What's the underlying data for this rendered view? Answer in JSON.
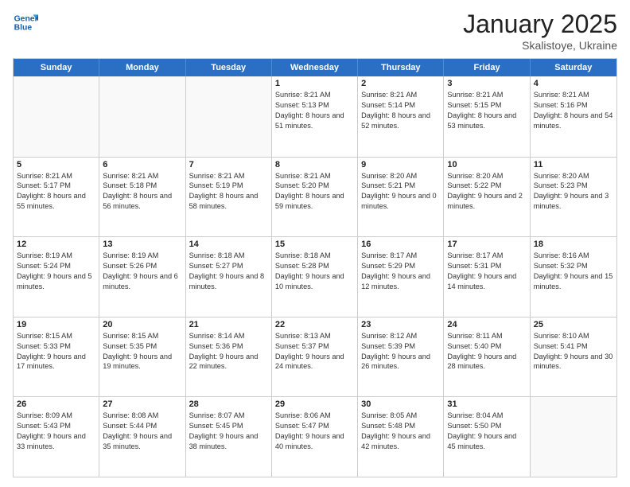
{
  "header": {
    "logo_general": "General",
    "logo_blue": "Blue",
    "month_title": "January 2025",
    "location": "Skalistoye, Ukraine"
  },
  "weekdays": [
    "Sunday",
    "Monday",
    "Tuesday",
    "Wednesday",
    "Thursday",
    "Friday",
    "Saturday"
  ],
  "weeks": [
    [
      {
        "day": "",
        "sunrise": "",
        "sunset": "",
        "daylight": ""
      },
      {
        "day": "",
        "sunrise": "",
        "sunset": "",
        "daylight": ""
      },
      {
        "day": "",
        "sunrise": "",
        "sunset": "",
        "daylight": ""
      },
      {
        "day": "1",
        "sunrise": "Sunrise: 8:21 AM",
        "sunset": "Sunset: 5:13 PM",
        "daylight": "Daylight: 8 hours and 51 minutes."
      },
      {
        "day": "2",
        "sunrise": "Sunrise: 8:21 AM",
        "sunset": "Sunset: 5:14 PM",
        "daylight": "Daylight: 8 hours and 52 minutes."
      },
      {
        "day": "3",
        "sunrise": "Sunrise: 8:21 AM",
        "sunset": "Sunset: 5:15 PM",
        "daylight": "Daylight: 8 hours and 53 minutes."
      },
      {
        "day": "4",
        "sunrise": "Sunrise: 8:21 AM",
        "sunset": "Sunset: 5:16 PM",
        "daylight": "Daylight: 8 hours and 54 minutes."
      }
    ],
    [
      {
        "day": "5",
        "sunrise": "Sunrise: 8:21 AM",
        "sunset": "Sunset: 5:17 PM",
        "daylight": "Daylight: 8 hours and 55 minutes."
      },
      {
        "day": "6",
        "sunrise": "Sunrise: 8:21 AM",
        "sunset": "Sunset: 5:18 PM",
        "daylight": "Daylight: 8 hours and 56 minutes."
      },
      {
        "day": "7",
        "sunrise": "Sunrise: 8:21 AM",
        "sunset": "Sunset: 5:19 PM",
        "daylight": "Daylight: 8 hours and 58 minutes."
      },
      {
        "day": "8",
        "sunrise": "Sunrise: 8:21 AM",
        "sunset": "Sunset: 5:20 PM",
        "daylight": "Daylight: 8 hours and 59 minutes."
      },
      {
        "day": "9",
        "sunrise": "Sunrise: 8:20 AM",
        "sunset": "Sunset: 5:21 PM",
        "daylight": "Daylight: 9 hours and 0 minutes."
      },
      {
        "day": "10",
        "sunrise": "Sunrise: 8:20 AM",
        "sunset": "Sunset: 5:22 PM",
        "daylight": "Daylight: 9 hours and 2 minutes."
      },
      {
        "day": "11",
        "sunrise": "Sunrise: 8:20 AM",
        "sunset": "Sunset: 5:23 PM",
        "daylight": "Daylight: 9 hours and 3 minutes."
      }
    ],
    [
      {
        "day": "12",
        "sunrise": "Sunrise: 8:19 AM",
        "sunset": "Sunset: 5:24 PM",
        "daylight": "Daylight: 9 hours and 5 minutes."
      },
      {
        "day": "13",
        "sunrise": "Sunrise: 8:19 AM",
        "sunset": "Sunset: 5:26 PM",
        "daylight": "Daylight: 9 hours and 6 minutes."
      },
      {
        "day": "14",
        "sunrise": "Sunrise: 8:18 AM",
        "sunset": "Sunset: 5:27 PM",
        "daylight": "Daylight: 9 hours and 8 minutes."
      },
      {
        "day": "15",
        "sunrise": "Sunrise: 8:18 AM",
        "sunset": "Sunset: 5:28 PM",
        "daylight": "Daylight: 9 hours and 10 minutes."
      },
      {
        "day": "16",
        "sunrise": "Sunrise: 8:17 AM",
        "sunset": "Sunset: 5:29 PM",
        "daylight": "Daylight: 9 hours and 12 minutes."
      },
      {
        "day": "17",
        "sunrise": "Sunrise: 8:17 AM",
        "sunset": "Sunset: 5:31 PM",
        "daylight": "Daylight: 9 hours and 14 minutes."
      },
      {
        "day": "18",
        "sunrise": "Sunrise: 8:16 AM",
        "sunset": "Sunset: 5:32 PM",
        "daylight": "Daylight: 9 hours and 15 minutes."
      }
    ],
    [
      {
        "day": "19",
        "sunrise": "Sunrise: 8:15 AM",
        "sunset": "Sunset: 5:33 PM",
        "daylight": "Daylight: 9 hours and 17 minutes."
      },
      {
        "day": "20",
        "sunrise": "Sunrise: 8:15 AM",
        "sunset": "Sunset: 5:35 PM",
        "daylight": "Daylight: 9 hours and 19 minutes."
      },
      {
        "day": "21",
        "sunrise": "Sunrise: 8:14 AM",
        "sunset": "Sunset: 5:36 PM",
        "daylight": "Daylight: 9 hours and 22 minutes."
      },
      {
        "day": "22",
        "sunrise": "Sunrise: 8:13 AM",
        "sunset": "Sunset: 5:37 PM",
        "daylight": "Daylight: 9 hours and 24 minutes."
      },
      {
        "day": "23",
        "sunrise": "Sunrise: 8:12 AM",
        "sunset": "Sunset: 5:39 PM",
        "daylight": "Daylight: 9 hours and 26 minutes."
      },
      {
        "day": "24",
        "sunrise": "Sunrise: 8:11 AM",
        "sunset": "Sunset: 5:40 PM",
        "daylight": "Daylight: 9 hours and 28 minutes."
      },
      {
        "day": "25",
        "sunrise": "Sunrise: 8:10 AM",
        "sunset": "Sunset: 5:41 PM",
        "daylight": "Daylight: 9 hours and 30 minutes."
      }
    ],
    [
      {
        "day": "26",
        "sunrise": "Sunrise: 8:09 AM",
        "sunset": "Sunset: 5:43 PM",
        "daylight": "Daylight: 9 hours and 33 minutes."
      },
      {
        "day": "27",
        "sunrise": "Sunrise: 8:08 AM",
        "sunset": "Sunset: 5:44 PM",
        "daylight": "Daylight: 9 hours and 35 minutes."
      },
      {
        "day": "28",
        "sunrise": "Sunrise: 8:07 AM",
        "sunset": "Sunset: 5:45 PM",
        "daylight": "Daylight: 9 hours and 38 minutes."
      },
      {
        "day": "29",
        "sunrise": "Sunrise: 8:06 AM",
        "sunset": "Sunset: 5:47 PM",
        "daylight": "Daylight: 9 hours and 40 minutes."
      },
      {
        "day": "30",
        "sunrise": "Sunrise: 8:05 AM",
        "sunset": "Sunset: 5:48 PM",
        "daylight": "Daylight: 9 hours and 42 minutes."
      },
      {
        "day": "31",
        "sunrise": "Sunrise: 8:04 AM",
        "sunset": "Sunset: 5:50 PM",
        "daylight": "Daylight: 9 hours and 45 minutes."
      },
      {
        "day": "",
        "sunrise": "",
        "sunset": "",
        "daylight": ""
      }
    ]
  ]
}
